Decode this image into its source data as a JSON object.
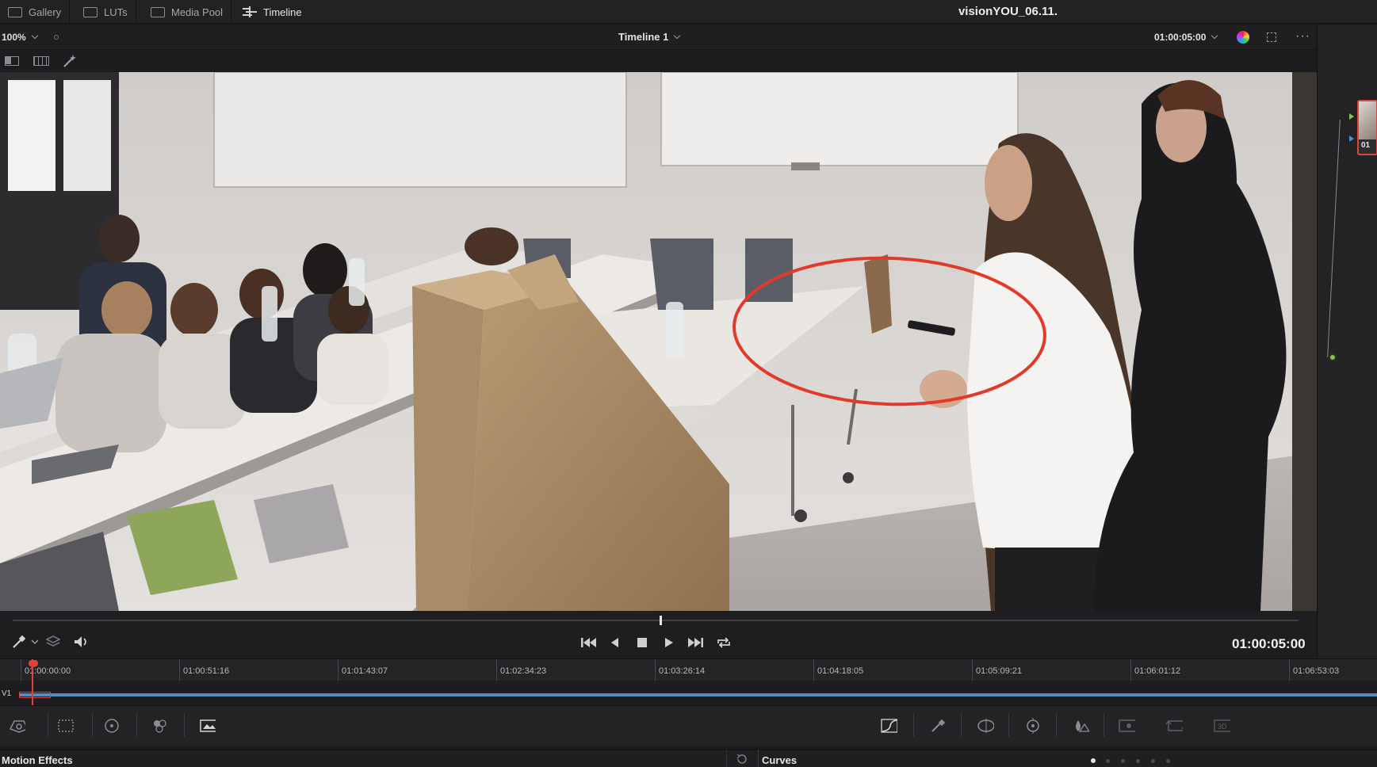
{
  "tabs": [
    {
      "label": "Gallery",
      "icon": "gallery-icon"
    },
    {
      "label": "LUTs",
      "icon": "luts-icon"
    },
    {
      "label": "Media Pool",
      "icon": "media-pool-icon"
    },
    {
      "label": "Timeline",
      "icon": "timeline-icon",
      "active": true
    }
  ],
  "project_title": "visionYOU_06.11.",
  "viewer": {
    "zoom": "100%",
    "timeline_name": "Timeline 1",
    "timecode_top": "01:00:05:00",
    "timecode_main": "01:00:05:00"
  },
  "node": {
    "label": "01"
  },
  "ruler": {
    "ticks": [
      "01:00:00:00",
      "01:00:51:16",
      "01:01:43:07",
      "01:02:34:23",
      "01:03:26:14",
      "01:04:18:05",
      "01:05:09:21",
      "01:06:01:12",
      "01:06:53:03"
    ]
  },
  "track": {
    "label": "V1"
  },
  "panels": {
    "left": "Motion Effects",
    "right": "Curves"
  },
  "colors": {
    "accent_red": "#e2403a",
    "clip_blue": "#4a8fc8",
    "annotation_red": "#e23a2a"
  }
}
